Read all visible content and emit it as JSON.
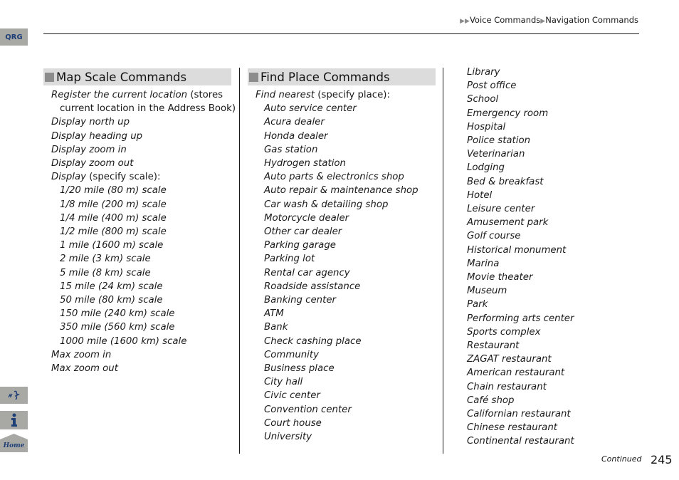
{
  "breadcrumb": {
    "items": [
      "Voice Commands",
      "Navigation Commands"
    ]
  },
  "side_tabs": {
    "qrg": "QRG",
    "voice": "voice-command-icon",
    "info": "info-icon",
    "home": "Home"
  },
  "map_scale": {
    "title": "Map Scale Commands",
    "register_italic": "Register the current location",
    "register_plain": " (stores",
    "register_cont": "current location in the Address Book)",
    "items_top": [
      "Display north up",
      "Display heading up",
      "Display zoom in",
      "Display zoom out"
    ],
    "display_italic": "Display",
    "display_plain": " (specify scale):",
    "scales": [
      "1/20 mile (80 m) scale",
      "1/8 mile (200 m) scale",
      "1/4 mile (400 m) scale",
      "1/2 mile (800 m) scale",
      "1 mile (1600 m) scale",
      "2 mile (3 km) scale",
      "5 mile (8 km) scale",
      "15 mile (24 km) scale",
      "50 mile (80 km) scale",
      "150 mile (240 km) scale",
      "350 mile (560 km) scale",
      "1000 mile (1600 km) scale"
    ],
    "items_bottom": [
      "Max zoom in",
      "Max zoom out"
    ]
  },
  "find_place": {
    "title": "Find Place Commands",
    "find_italic": "Find nearest",
    "find_plain": " (specify place):",
    "places_col2": [
      "Auto service center",
      "Acura dealer",
      "Honda dealer",
      "Gas station",
      "Hydrogen station",
      "Auto parts & electronics shop",
      "Auto repair & maintenance shop",
      "Car wash & detailing shop",
      "Motorcycle dealer",
      "Other car dealer",
      "Parking garage",
      "Parking lot",
      "Rental car agency",
      "Roadside assistance",
      "Banking center",
      "ATM",
      "Bank",
      "Check cashing place",
      "Community",
      "Business place",
      "City hall",
      "Civic center",
      "Convention center",
      "Court house",
      "University"
    ],
    "places_col3": [
      "Library",
      "Post office",
      "School",
      "Emergency room",
      "Hospital",
      "Police station",
      "Veterinarian",
      "Lodging",
      "Bed & breakfast",
      "Hotel",
      "Leisure center",
      "Amusement park",
      "Golf course",
      "Historical monument",
      "Marina",
      "Movie theater",
      "Museum",
      "Park",
      "Performing arts center",
      "Sports complex",
      "Restaurant",
      "ZAGAT restaurant",
      "American restaurant",
      "Chain restaurant",
      "Café shop",
      "Californian restaurant",
      "Chinese restaurant",
      "Continental restaurant"
    ]
  },
  "footer": {
    "continued": "Continued",
    "page_number": "245"
  },
  "colors": {
    "tab_gray": "#a8a8a5",
    "tab_blue": "#1f3f77",
    "section_bg": "#dcdcdc",
    "section_square": "#8c8c8c"
  }
}
